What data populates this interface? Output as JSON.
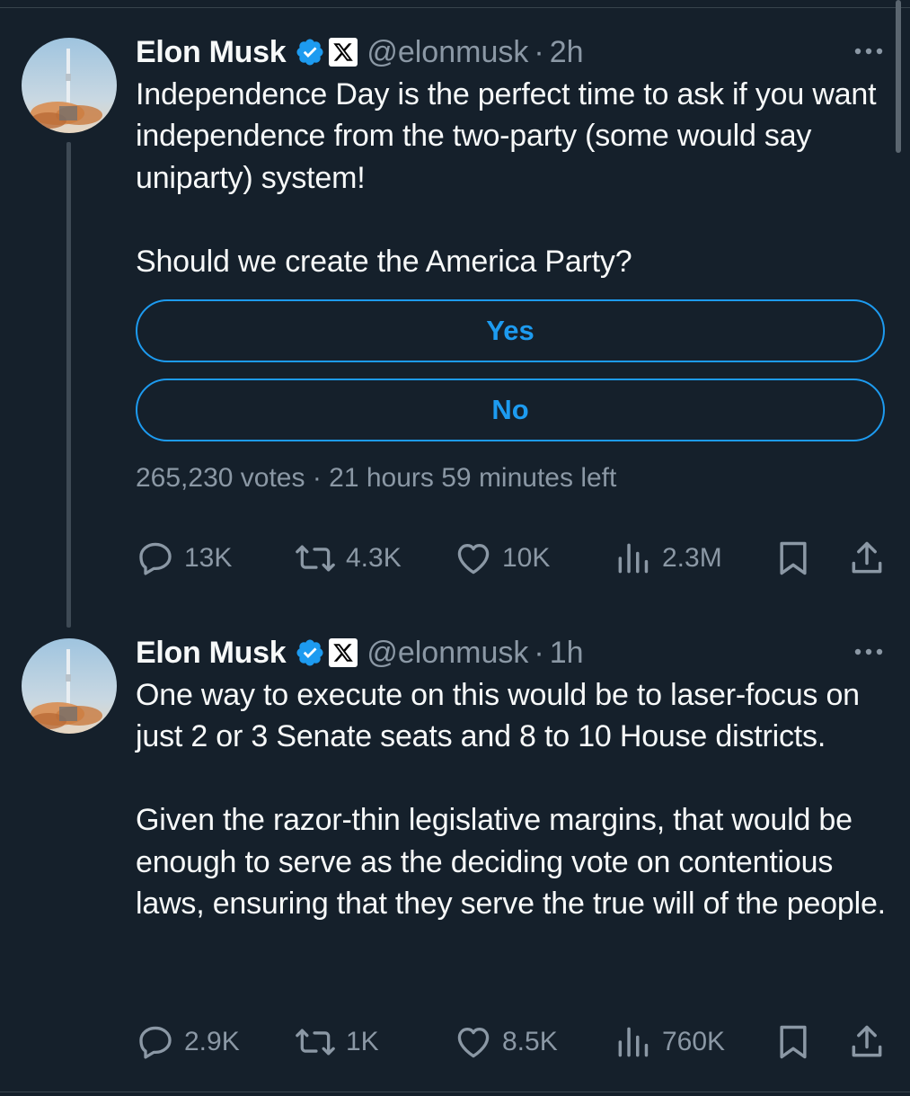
{
  "colors": {
    "background": "#15202b",
    "accent": "#1d9bf0",
    "muted": "#8b98a5",
    "text": "#f7f9f9"
  },
  "tweets": [
    {
      "author": {
        "name": "Elon Musk",
        "handle": "@elonmusk",
        "time": "2h",
        "verified": true,
        "affiliation_badge": "x-logo-icon"
      },
      "text_paragraphs": [
        "Independence Day is the perfect time to ask if you want independence from the two-party (some would say uniparty) system!",
        "Should we create the America Party?"
      ],
      "poll": {
        "options": [
          "Yes",
          "No"
        ],
        "votes": "265,230 votes",
        "time_left": "21 hours 59 minutes left"
      },
      "stats": {
        "replies": "13K",
        "reposts": "4.3K",
        "likes": "10K",
        "views": "2.3M"
      }
    },
    {
      "author": {
        "name": "Elon Musk",
        "handle": "@elonmusk",
        "time": "1h",
        "verified": true,
        "affiliation_badge": "x-logo-icon"
      },
      "text_paragraphs": [
        "One way to execute on this would be to laser-focus on just 2 or 3 Senate seats and 8 to 10 House districts.",
        "Given the razor-thin legislative margins, that would be enough to serve as the deciding vote on contentious laws, ensuring that they serve the true will of the people."
      ],
      "stats": {
        "replies": "2.9K",
        "reposts": "1K",
        "likes": "8.5K",
        "views": "760K"
      }
    }
  ]
}
